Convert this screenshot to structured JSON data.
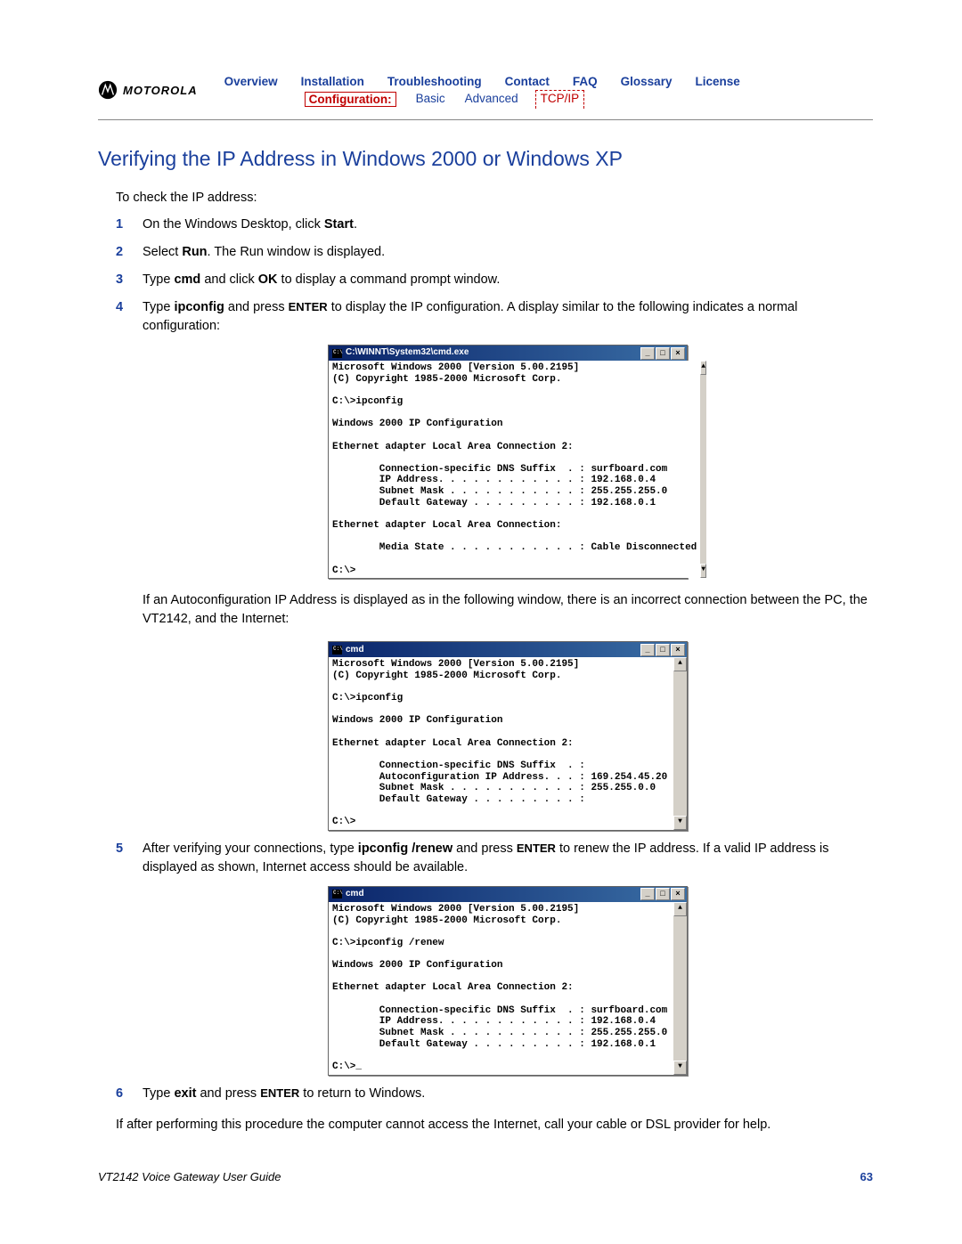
{
  "brand": "MOTOROLA",
  "nav_top": [
    "Overview",
    "Installation",
    "Troubleshooting",
    "Contact",
    "FAQ",
    "Glossary",
    "License"
  ],
  "nav_sub": {
    "config": "Configuration:",
    "basic": "Basic",
    "advanced": "Advanced",
    "tcpip": "TCP/IP"
  },
  "title": "Verifying the IP Address in Windows 2000 or Windows XP",
  "intro": "To check the IP address:",
  "steps": {
    "s1_a": "On the Windows Desktop, click ",
    "s1_b": "Start",
    "s1_c": ".",
    "s2_a": "Select ",
    "s2_b": "Run",
    "s2_c": ". The Run window is displayed.",
    "s3_a": "Type ",
    "s3_b": "cmd",
    "s3_c": " and click ",
    "s3_d": "OK",
    "s3_e": " to display a command prompt window.",
    "s4_a": "Type ",
    "s4_b": "ipconfig",
    "s4_c": " and press ",
    "s4_enter": "ENTER",
    "s4_d": " to display the IP configuration. A display similar to the following indicates a normal configuration:",
    "s5_a": "After verifying your connections, type ",
    "s5_b": "ipconfig /renew",
    "s5_c": " and press ",
    "s5_enter": "ENTER",
    "s5_d": " to renew the IP address. If a valid IP address is displayed as shown, Internet access should be available.",
    "s6_a": "Type ",
    "s6_b": "exit",
    "s6_c": " and press ",
    "s6_enter": "ENTER",
    "s6_d": " to return to Windows."
  },
  "between_fig": "If an Autoconfiguration IP Address is displayed as in the following window, there is an incorrect connection between the PC, the VT2142, and the Internet:",
  "final_para": "If after performing this procedure the computer cannot access the Internet, call your cable or DSL provider for help.",
  "win_btn_min": "_",
  "win_btn_max": "□",
  "win_btn_close": "×",
  "scroll_up": "▲",
  "scroll_down": "▼",
  "cmd1": {
    "title": "C:\\WINNT\\System32\\cmd.exe",
    "body": "Microsoft Windows 2000 [Version 5.00.2195]\n(C) Copyright 1985-2000 Microsoft Corp.\n\nC:\\>ipconfig\n\nWindows 2000 IP Configuration\n\nEthernet adapter Local Area Connection 2:\n\n        Connection-specific DNS Suffix  . : surfboard.com\n        IP Address. . . . . . . . . . . . : 192.168.0.4\n        Subnet Mask . . . . . . . . . . . : 255.255.255.0\n        Default Gateway . . . . . . . . . : 192.168.0.1\n\nEthernet adapter Local Area Connection:\n\n        Media State . . . . . . . . . . . : Cable Disconnected\n\nC:\\>"
  },
  "cmd2": {
    "title": "cmd",
    "body": "Microsoft Windows 2000 [Version 5.00.2195]\n(C) Copyright 1985-2000 Microsoft Corp.\n\nC:\\>ipconfig\n\nWindows 2000 IP Configuration\n\nEthernet adapter Local Area Connection 2:\n\n        Connection-specific DNS Suffix  . :\n        Autoconfiguration IP Address. . . : 169.254.45.20\n        Subnet Mask . . . . . . . . . . . : 255.255.0.0\n        Default Gateway . . . . . . . . . :\n\nC:\\>"
  },
  "cmd3": {
    "title": "cmd",
    "body": "Microsoft Windows 2000 [Version 5.00.2195]\n(C) Copyright 1985-2000 Microsoft Corp.\n\nC:\\>ipconfig /renew\n\nWindows 2000 IP Configuration\n\nEthernet adapter Local Area Connection 2:\n\n        Connection-specific DNS Suffix  . : surfboard.com\n        IP Address. . . . . . . . . . . . : 192.168.0.4\n        Subnet Mask . . . . . . . . . . . : 255.255.255.0\n        Default Gateway . . . . . . . . . : 192.168.0.1\n\nC:\\>_"
  },
  "footer_left": "VT2142 Voice Gateway User Guide",
  "footer_right": "63"
}
